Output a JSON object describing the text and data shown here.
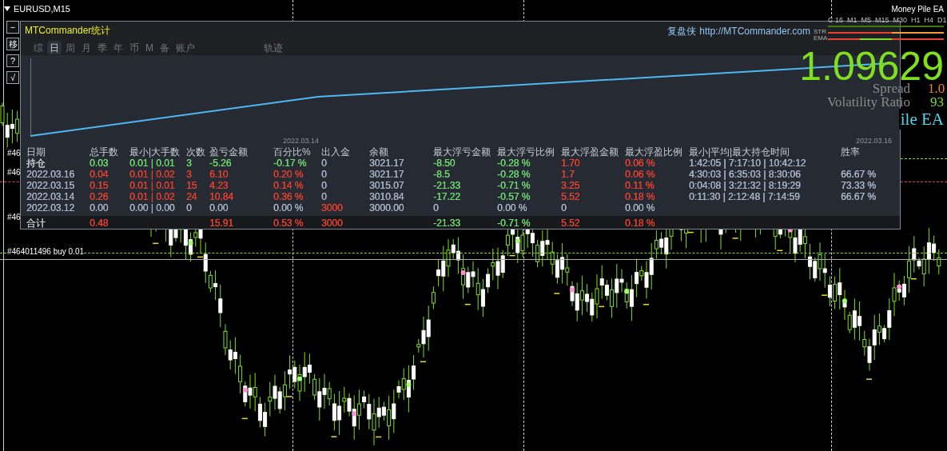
{
  "chart": {
    "symbol": "EURUSD,M15",
    "ea_name": "Money Pile EA",
    "timeframes": [
      "C 16",
      "M1",
      "M5",
      "M15",
      "M30",
      "H1",
      "H4",
      "D1"
    ],
    "indicator_labels": [
      "STR",
      "EMA"
    ],
    "price": "1.09629",
    "spread_label": "Spread",
    "spread": "1.0",
    "volatility_label": "Volatility Ratio",
    "volatility": "93",
    "ea_name_large": "ile EA",
    "order_labels": [
      "#46",
      "#46",
      "#46",
      "#464011496 buy 0.01"
    ]
  },
  "side_buttons": [
    "−",
    "移",
    "?",
    "√"
  ],
  "panel": {
    "title": "MTCommander统计",
    "link_prefix": "复盘侠",
    "link": "http://MTCommander.com",
    "tabs": [
      {
        "label": "综",
        "selected": false
      },
      {
        "label": "日",
        "selected": true
      },
      {
        "label": "周",
        "selected": false
      },
      {
        "label": "月",
        "selected": false
      },
      {
        "label": "季",
        "selected": false
      },
      {
        "label": "年",
        "selected": false
      },
      {
        "label": "币",
        "selected": false
      },
      {
        "label": "M",
        "selected": false
      },
      {
        "label": "备",
        "selected": false
      },
      {
        "label": "账户",
        "selected": false
      },
      {
        "label": "轨迹",
        "selected": false
      }
    ],
    "equity_chart": {
      "x_labels": [
        "2022.03.14",
        "2022.03.16"
      ]
    },
    "table": {
      "columns": [
        "日期",
        "总手数",
        "最小|大手数",
        "次数",
        "盈亏金额",
        "百分比%",
        "出入金",
        "余额",
        "最大浮亏金额",
        "最大浮亏比例",
        "最大浮盈金额",
        "最大浮盈比例",
        "最小|平均|最大持仓时间",
        "胜率"
      ],
      "rows": [
        {
          "cells": [
            {
              "text": "持仓",
              "color": "#c8ccd2"
            },
            {
              "text": "0.03",
              "color": "#6fdc6f"
            },
            {
              "text": "0.01 | 0.01",
              "color": "#6fdc6f"
            },
            {
              "text": "3",
              "color": "#6fdc6f"
            },
            {
              "text": "-5.26",
              "color": "#6fdc6f"
            },
            {
              "text": "-0.17 %",
              "color": "#6fdc6f"
            },
            {
              "text": "0",
              "color": "#a9b4c8"
            },
            {
              "text": "3021.17",
              "color": "#a9b4c8"
            },
            {
              "text": "-8.50",
              "color": "#6fdc6f"
            },
            {
              "text": "-0.28 %",
              "color": "#6fdc6f"
            },
            {
              "text": "1.70",
              "color": "#e8412f"
            },
            {
              "text": "0.06 %",
              "color": "#e8412f"
            },
            {
              "text": "1:42:05 | 7:17:10 | 10:42:12",
              "color": "#a9b4c8"
            },
            null
          ]
        },
        {
          "cells": [
            {
              "text": "2022.03.16",
              "color": "#a9b4c8"
            },
            {
              "text": "0.04",
              "color": "#e8412f"
            },
            {
              "text": "0.01 | 0.02",
              "color": "#e8412f"
            },
            {
              "text": "3",
              "color": "#e8412f"
            },
            {
              "text": "6.10",
              "color": "#e8412f"
            },
            {
              "text": "0.20 %",
              "color": "#e8412f"
            },
            {
              "text": "0",
              "color": "#a9b4c8"
            },
            {
              "text": "3021.17",
              "color": "#a9b4c8"
            },
            {
              "text": "-8.5",
              "color": "#6fdc6f"
            },
            {
              "text": "-0.28 %",
              "color": "#6fdc6f"
            },
            {
              "text": "1.7",
              "color": "#e8412f"
            },
            {
              "text": "0.06 %",
              "color": "#e8412f"
            },
            {
              "text": "4:30:03 | 6:35:03 | 8:30:06",
              "color": "#a9b4c8"
            },
            {
              "text": "66.67 %",
              "color": "#a9b4c8"
            }
          ]
        },
        {
          "cells": [
            {
              "text": "2022.03.15",
              "color": "#a9b4c8"
            },
            {
              "text": "0.15",
              "color": "#e8412f"
            },
            {
              "text": "0.01 | 0.01",
              "color": "#e8412f"
            },
            {
              "text": "15",
              "color": "#e8412f"
            },
            {
              "text": "4.23",
              "color": "#e8412f"
            },
            {
              "text": "0.14 %",
              "color": "#e8412f"
            },
            {
              "text": "0",
              "color": "#a9b4c8"
            },
            {
              "text": "3015.07",
              "color": "#a9b4c8"
            },
            {
              "text": "-21.33",
              "color": "#6fdc6f"
            },
            {
              "text": "-0.71 %",
              "color": "#6fdc6f"
            },
            {
              "text": "3.25",
              "color": "#e8412f"
            },
            {
              "text": "0.11 %",
              "color": "#e8412f"
            },
            {
              "text": "0:04:08 | 3:21:32 | 8:19:29",
              "color": "#a9b4c8"
            },
            {
              "text": "73.33 %",
              "color": "#a9b4c8"
            }
          ]
        },
        {
          "cells": [
            {
              "text": "2022.03.14",
              "color": "#a9b4c8"
            },
            {
              "text": "0.26",
              "color": "#e8412f"
            },
            {
              "text": "0.01 | 0.02",
              "color": "#e8412f"
            },
            {
              "text": "24",
              "color": "#e8412f"
            },
            {
              "text": "10.84",
              "color": "#e8412f"
            },
            {
              "text": "0.36 %",
              "color": "#e8412f"
            },
            {
              "text": "0",
              "color": "#a9b4c8"
            },
            {
              "text": "3010.84",
              "color": "#a9b4c8"
            },
            {
              "text": "-17.22",
              "color": "#6fdc6f"
            },
            {
              "text": "-0.57 %",
              "color": "#6fdc6f"
            },
            {
              "text": "5.52",
              "color": "#e8412f"
            },
            {
              "text": "0.18 %",
              "color": "#e8412f"
            },
            {
              "text": "0:11:30 | 2:12:48 | 7:14:59",
              "color": "#a9b4c8"
            },
            {
              "text": "66.67 %",
              "color": "#a9b4c8"
            }
          ]
        },
        {
          "cells": [
            {
              "text": "2022.03.12",
              "color": "#a9b4c8"
            },
            {
              "text": "0.00",
              "color": "#a9b4c8"
            },
            {
              "text": "0.00 | 0.00",
              "color": "#a9b4c8"
            },
            {
              "text": "0",
              "color": "#a9b4c8"
            },
            {
              "text": "0.00",
              "color": "#a9b4c8"
            },
            {
              "text": "0.00 %",
              "color": "#a9b4c8"
            },
            {
              "text": "3000",
              "color": "#e8412f"
            },
            {
              "text": "3000.00",
              "color": "#a9b4c8"
            },
            {
              "text": "0",
              "color": "#a9b4c8"
            },
            {
              "text": "0.00 %",
              "color": "#a9b4c8"
            },
            {
              "text": "0",
              "color": "#a9b4c8"
            },
            {
              "text": "0.00 %",
              "color": "#a9b4c8"
            },
            null,
            null
          ]
        }
      ],
      "total": {
        "cells": [
          {
            "text": "合计",
            "color": "#c8ccd2"
          },
          {
            "text": "0.48",
            "color": "#e8412f"
          },
          null,
          null,
          {
            "text": "15.91",
            "color": "#e8412f"
          },
          {
            "text": "0.53 %",
            "color": "#e8412f"
          },
          {
            "text": "3000",
            "color": "#e8412f"
          },
          null,
          {
            "text": "-21.33",
            "color": "#6fdc6f"
          },
          {
            "text": "-0.71 %",
            "color": "#6fdc6f"
          },
          {
            "text": "5.52",
            "color": "#e8412f"
          },
          {
            "text": "0.18 %",
            "color": "#e8412f"
          },
          null,
          null
        ]
      }
    }
  }
}
